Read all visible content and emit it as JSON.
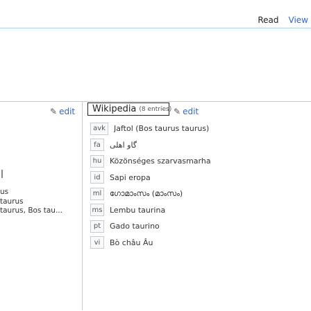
{
  "tabs": {
    "read": "Read",
    "view": "View"
  },
  "left": {
    "edit_label": "edit",
    "lines": [
      "us",
      "taurus",
      "taurus, Bos tau..."
    ]
  },
  "wikidata": {
    "title": "Wikipedia",
    "count": "(8 entries)",
    "edit_label": "edit"
  },
  "names": [
    {
      "lang": "avk",
      "value": "Jaftol (Bos taurus taurus)"
    },
    {
      "lang": "fa",
      "value": "گاو اهلی"
    },
    {
      "lang": "hu",
      "value": "Közönséges szarvasmarha"
    },
    {
      "lang": "id",
      "value": "Sapi eropa"
    },
    {
      "lang": "ml",
      "value": "ഗോമാംസം (മാംസം)"
    },
    {
      "lang": "ms",
      "value": "Lembu taurina"
    },
    {
      "lang": "pt",
      "value": "Gado taurino"
    },
    {
      "lang": "vi",
      "value": "Bò châu Âu"
    }
  ]
}
